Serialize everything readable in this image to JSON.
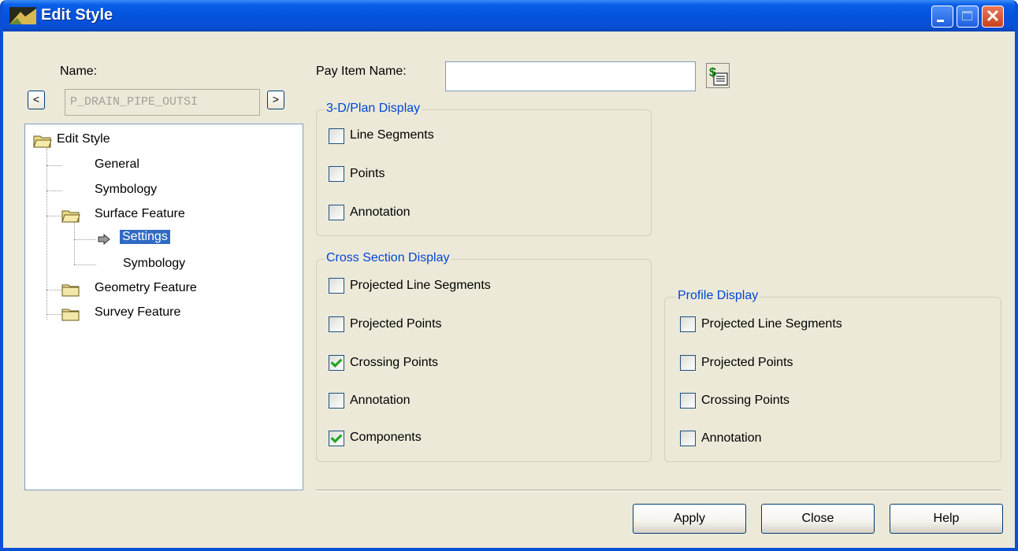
{
  "window": {
    "title": "Edit Style",
    "close_glyph": "✕"
  },
  "left": {
    "name_label": "Name:",
    "name_value": "P_DRAIN_PIPE_OUTSI",
    "prev_glyph": "<",
    "next_glyph": ">",
    "tree": [
      {
        "label": "Edit Style",
        "icon": "folder-open-icon"
      },
      {
        "label": "General"
      },
      {
        "label": "Symbology"
      },
      {
        "label": "Surface Feature",
        "icon": "folder-open-icon"
      },
      {
        "label": "Settings",
        "icon": "arrow-right-icon",
        "selected": true
      },
      {
        "label": "Symbology"
      },
      {
        "label": "Geometry Feature",
        "icon": "folder-closed-icon"
      },
      {
        "label": "Survey Feature",
        "icon": "folder-closed-icon"
      }
    ]
  },
  "pay_item": {
    "label": "Pay Item Name:",
    "value": ""
  },
  "plan_display": {
    "title": "3-D/Plan Display",
    "items": [
      {
        "label": "Line Segments",
        "checked": false
      },
      {
        "label": "Points",
        "checked": false
      },
      {
        "label": "Annotation",
        "checked": false
      }
    ]
  },
  "cross_section_display": {
    "title": "Cross Section Display",
    "items": [
      {
        "label": "Projected Line Segments",
        "checked": false
      },
      {
        "label": "Projected Points",
        "checked": false
      },
      {
        "label": "Crossing Points",
        "checked": true
      },
      {
        "label": "Annotation",
        "checked": false
      },
      {
        "label": "Components",
        "checked": true
      }
    ]
  },
  "profile_display": {
    "title": "Profile Display",
    "items": [
      {
        "label": "Projected Line Segments",
        "checked": false
      },
      {
        "label": "Projected Points",
        "checked": false
      },
      {
        "label": "Crossing Points",
        "checked": false
      },
      {
        "label": "Annotation",
        "checked": false
      }
    ]
  },
  "buttons": {
    "apply": "Apply",
    "close": "Close",
    "help": "Help"
  }
}
